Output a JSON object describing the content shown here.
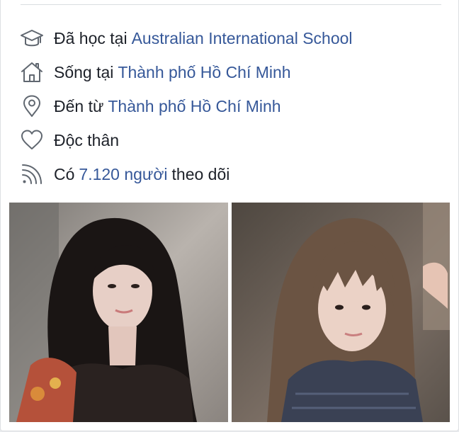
{
  "intro": {
    "education": {
      "icon": "graduation-cap-icon",
      "prefix": "Đã học tại",
      "link": "Australian International School"
    },
    "lives_in": {
      "icon": "home-icon",
      "prefix": "Sống tại",
      "link": "Thành phố Hồ Chí Minh"
    },
    "from": {
      "icon": "location-pin-icon",
      "prefix": "Đến từ",
      "link": "Thành phố Hồ Chí Minh"
    },
    "relationship": {
      "icon": "heart-icon",
      "text": "Độc thân"
    },
    "followers": {
      "icon": "rss-feed-icon",
      "prefix": "Có",
      "link": "7.120 người",
      "suffix": "theo dõi"
    }
  },
  "photos": [
    {
      "label": ""
    },
    {
      "label": ""
    }
  ],
  "colors": {
    "link": "#365899",
    "text": "#1d2129",
    "icon": "#606770",
    "card_background": "#ffffff",
    "page_background": "#e9ebee"
  }
}
